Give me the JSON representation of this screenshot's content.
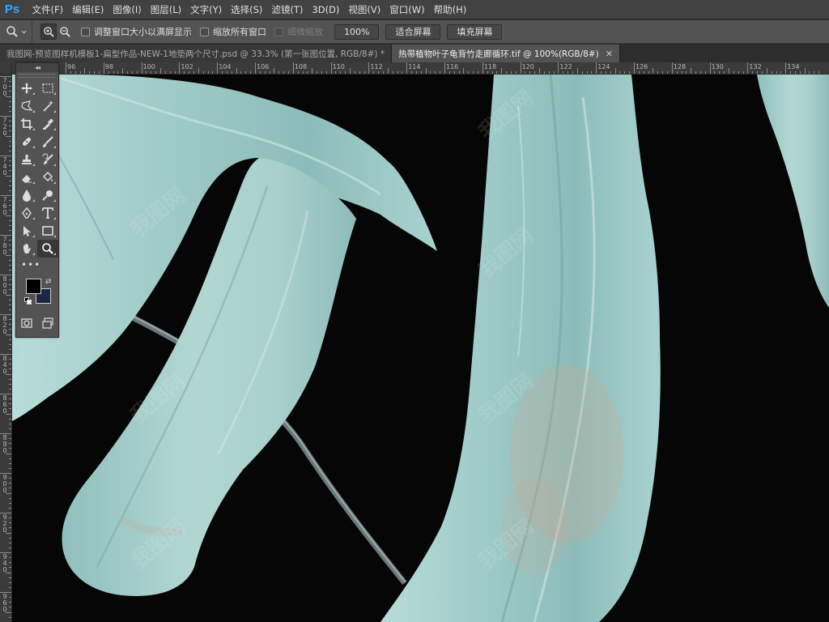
{
  "app": {
    "logo": "Ps"
  },
  "menu": {
    "items": [
      {
        "label": "文件(F)"
      },
      {
        "label": "编辑(E)"
      },
      {
        "label": "图像(I)"
      },
      {
        "label": "图层(L)"
      },
      {
        "label": "文字(Y)"
      },
      {
        "label": "选择(S)"
      },
      {
        "label": "滤镜(T)"
      },
      {
        "label": "3D(D)"
      },
      {
        "label": "视图(V)"
      },
      {
        "label": "窗口(W)"
      },
      {
        "label": "帮助(H)"
      }
    ]
  },
  "options": {
    "tool_icon": "zoom-icon",
    "zoom_in_icon": "zoom-in-icon",
    "zoom_out_icon": "zoom-out-icon",
    "resize_windows_label": "调整窗口大小以满屏显示",
    "zoom_all_windows_label": "缩放所有窗口",
    "scrubby_zoom_label": "细微缩放",
    "zoom_100_label": "100%",
    "fit_screen_label": "适合屏幕",
    "fill_screen_label": "填充屏幕"
  },
  "tabs": [
    {
      "title": "我图网-预览图样机模板1-扁型作品-NEW-1地垫两个尺寸.psd @ 33.3% (第一张图位置, RGB/8#) *",
      "close": "✕",
      "active": false
    },
    {
      "title": "热带植物叶子龟背竹走廊循环.tif @ 100%(RGB/8#)",
      "close": "✕",
      "active": true
    }
  ],
  "rulers": {
    "h_labels": [
      "96",
      "98",
      "100",
      "102",
      "104",
      "106",
      "108",
      "110",
      "112",
      "114",
      "116",
      "118",
      "120",
      "122",
      "124",
      "126",
      "128",
      "130",
      "132",
      "134"
    ],
    "v_labels": [
      "70",
      "72",
      "74",
      "76",
      "78",
      "80",
      "82",
      "84",
      "86",
      "88",
      "90",
      "92",
      "94",
      "96"
    ]
  },
  "toolbar": {
    "collapse": "◂◂",
    "more": "•••",
    "tools": [
      {
        "name": "move-tool-icon"
      },
      {
        "name": "marquee-tool-icon"
      },
      {
        "name": "lasso-tool-icon"
      },
      {
        "name": "magic-wand-tool-icon"
      },
      {
        "name": "crop-tool-icon"
      },
      {
        "name": "eyedropper-tool-icon"
      },
      {
        "name": "healing-brush-tool-icon"
      },
      {
        "name": "brush-tool-icon"
      },
      {
        "name": "clone-stamp-tool-icon"
      },
      {
        "name": "history-brush-tool-icon"
      },
      {
        "name": "eraser-tool-icon"
      },
      {
        "name": "paint-bucket-tool-icon"
      },
      {
        "name": "blur-tool-icon"
      },
      {
        "name": "dodge-tool-icon"
      },
      {
        "name": "pen-tool-icon"
      },
      {
        "name": "type-tool-icon"
      },
      {
        "name": "path-selection-tool-icon"
      },
      {
        "name": "rectangle-tool-icon"
      },
      {
        "name": "hand-tool-icon"
      },
      {
        "name": "zoom-tool-icon",
        "active": true
      }
    ],
    "foreground_color": "#000000",
    "background_color": "#1c2748"
  },
  "canvas": {
    "background_color": "#060606",
    "leaf_color": "#9dcbc9",
    "watermark_text": "我图网"
  }
}
